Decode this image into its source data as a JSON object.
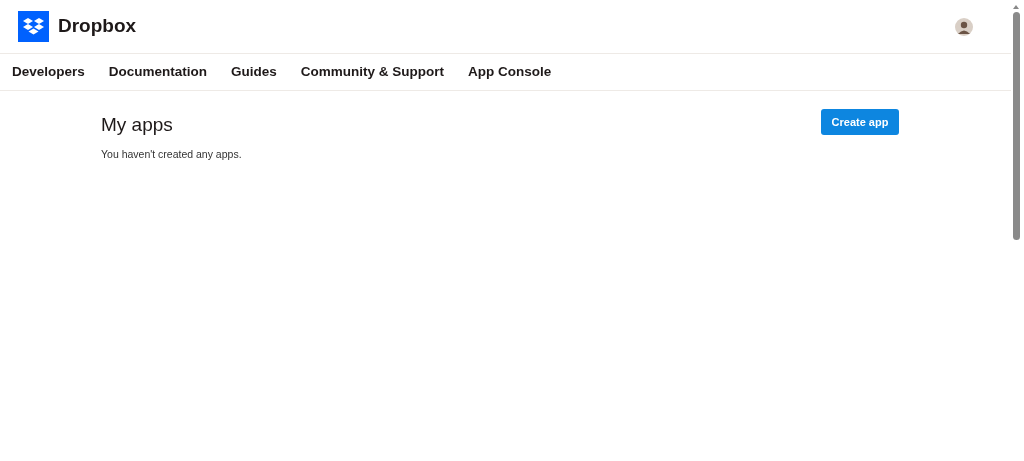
{
  "header": {
    "brand": "Dropbox"
  },
  "nav": [
    "Developers",
    "Documentation",
    "Guides",
    "Community & Support",
    "App Console"
  ],
  "page": {
    "title": "My apps",
    "empty_message": "You haven't created any apps.",
    "action": "Create app"
  }
}
